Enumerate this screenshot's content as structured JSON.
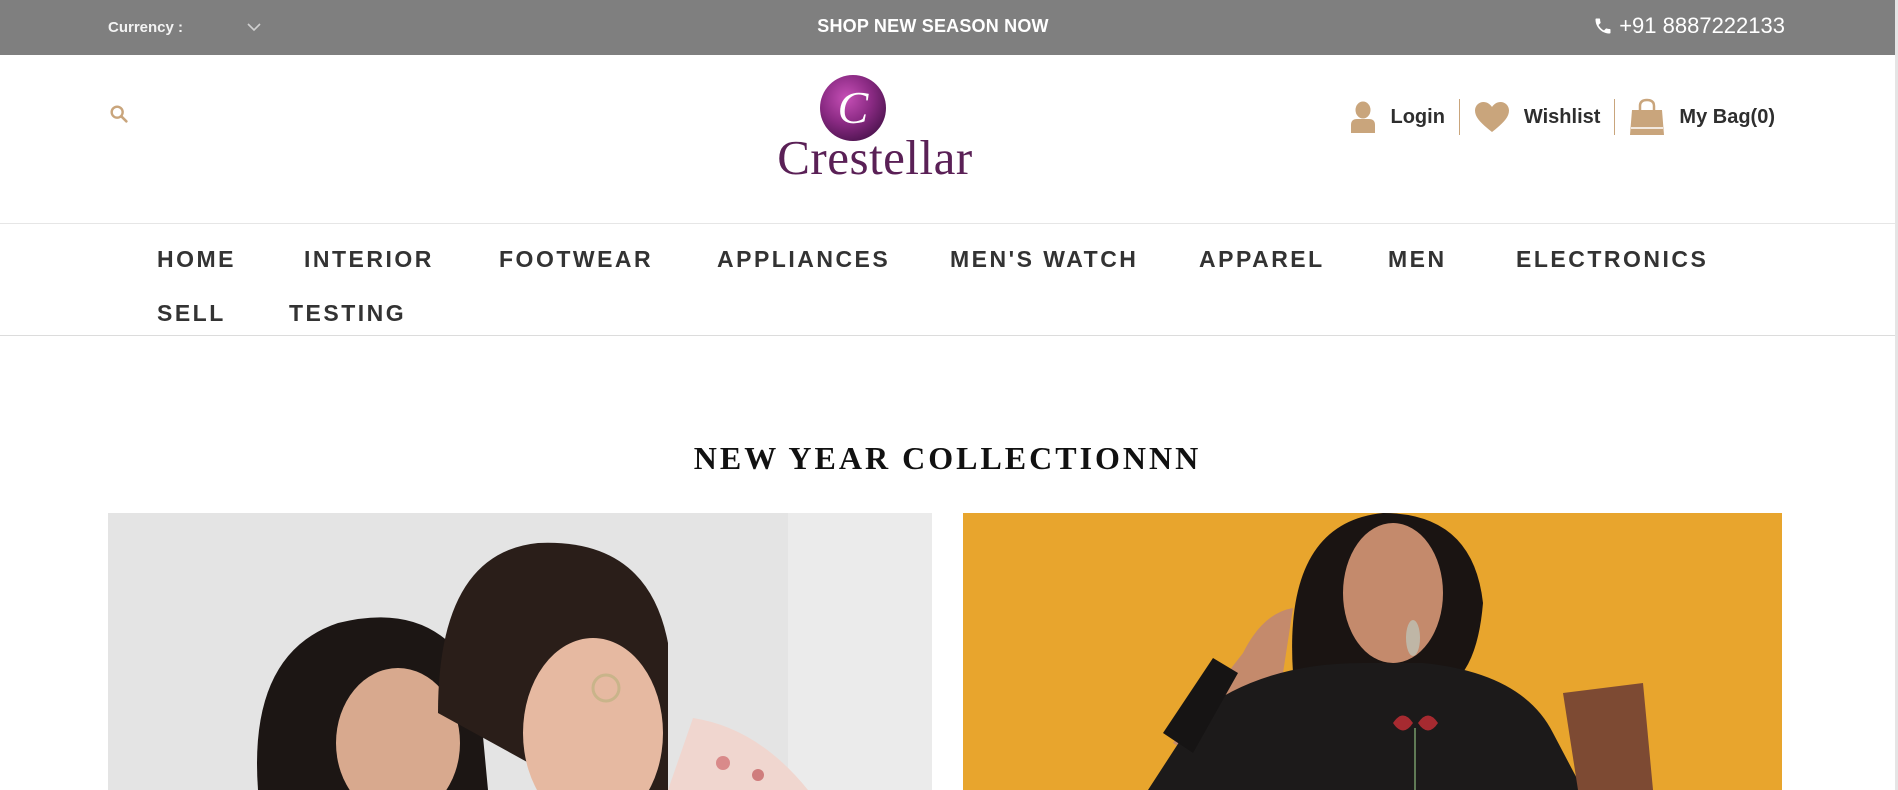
{
  "topbar": {
    "currency_label": "Currency :",
    "promo_text": "SHOP NEW SEASON NOW",
    "phone": "+91 8887222133"
  },
  "header": {
    "logo_text": "Crestellar",
    "logo_letter": "C",
    "login_label": "Login",
    "wishlist_label": "Wishlist",
    "bag_label": "My Bag(0)"
  },
  "nav": {
    "items": [
      "HOME",
      "INTERIOR",
      "FOOTWEAR",
      "APPLIANCES",
      "MEN'S WATCH",
      "APPAREL",
      "MEN",
      "ELECTRONICS",
      "SELL",
      "TESTING"
    ]
  },
  "main": {
    "section_title": "NEW YEAR COLLECTIONNN"
  },
  "colors": {
    "topbar_bg": "#7f7f7f",
    "accent_tan": "#c9a57c",
    "logo_purple": "#5a2056",
    "banner_right_bg": "#e8a52d"
  },
  "icons": {
    "currency_dropdown": "chevron-down-icon",
    "phone": "phone-icon",
    "search": "search-icon",
    "login": "user-icon",
    "wishlist": "heart-icon",
    "bag": "shopping-bag-icon"
  }
}
